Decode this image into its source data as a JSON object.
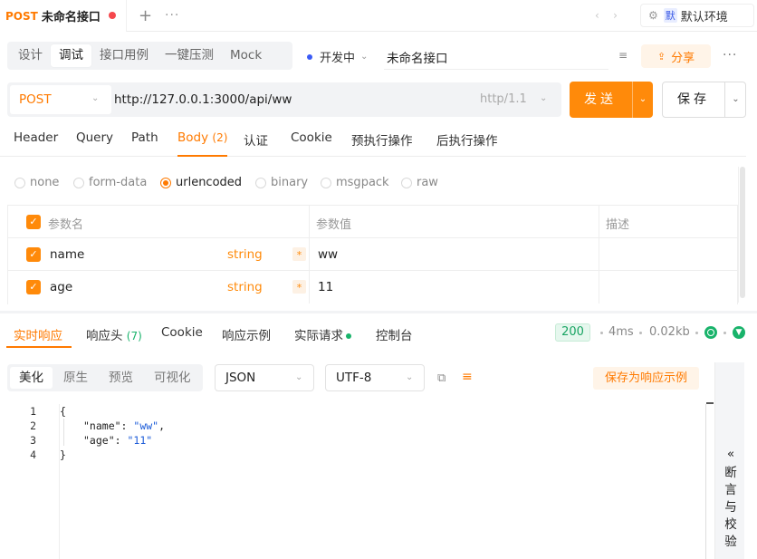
{
  "tabs": [
    {
      "method": "POST",
      "name": "未命名接口",
      "unsaved": true
    }
  ],
  "tab_add": "+",
  "tab_more": "···",
  "environment": {
    "badge": "默",
    "label": "默认环境"
  },
  "modes": [
    "设计",
    "调试",
    "接口用例",
    "一键压测",
    "Mock"
  ],
  "active_mode": "调试",
  "dev_env": "开发中",
  "api_name": "未命名接口",
  "share_label": "分享",
  "request": {
    "method": "POST",
    "url": "http://127.0.0.1:3000/api/ww",
    "http_version": "http/1.1",
    "send_label": "发送",
    "save_label": "保存"
  },
  "request_tabs": [
    {
      "label": "Header"
    },
    {
      "label": "Query"
    },
    {
      "label": "Path"
    },
    {
      "label": "Body",
      "count": "(2)"
    },
    {
      "label": "认证"
    },
    {
      "label": "Cookie"
    },
    {
      "label": "预执行操作"
    },
    {
      "label": "后执行操作"
    }
  ],
  "body_types": [
    "none",
    "form-data",
    "urlencoded",
    "binary",
    "msgpack",
    "raw"
  ],
  "selected_body_type": "urlencoded",
  "params": {
    "headers": [
      "参数名",
      "参数值",
      "描述"
    ],
    "rows": [
      {
        "name": "name",
        "type": "string",
        "required": "*",
        "value": "ww",
        "checked": true
      },
      {
        "name": "age",
        "type": "string",
        "required": "*",
        "value": "11",
        "checked": true
      }
    ]
  },
  "response_tabs": [
    {
      "label": "实时响应"
    },
    {
      "label": "响应头",
      "count": "(7)"
    },
    {
      "label": "Cookie"
    },
    {
      "label": "响应示例"
    },
    {
      "label": "实际请求"
    },
    {
      "label": "控制台"
    }
  ],
  "response_meta": {
    "status": "200",
    "time": "4ms",
    "size": "0.02kb"
  },
  "view_modes": [
    "美化",
    "原生",
    "预览",
    "可视化"
  ],
  "active_view_mode": "美化",
  "format": "JSON",
  "encoding": "UTF-8",
  "save_as_example": "保存为响应示例",
  "code": {
    "line_numbers": [
      "1",
      "2",
      "3",
      "4"
    ],
    "open_brace": "{",
    "lines": [
      {
        "key": "\"name\"",
        "value": "\"ww\"",
        "trail": ","
      },
      {
        "key": "\"age\"",
        "value": "\"11\"",
        "trail": ""
      }
    ],
    "close_brace": "}"
  },
  "side_panel": {
    "arrow": "«",
    "label": "断言与校验"
  }
}
